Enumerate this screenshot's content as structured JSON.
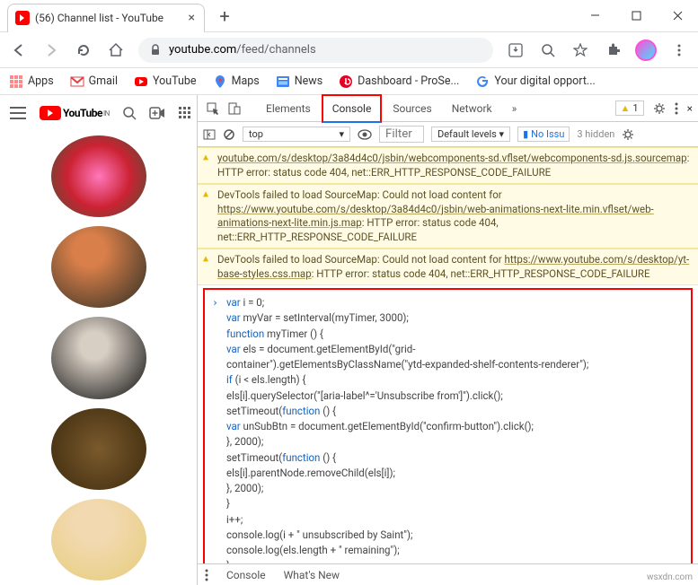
{
  "window": {
    "tab_title": "(56) Channel list - YouTube",
    "url_domain": "youtube.com",
    "url_path": "/feed/channels"
  },
  "bookmarks": [
    {
      "label": "Apps"
    },
    {
      "label": "Gmail"
    },
    {
      "label": "YouTube"
    },
    {
      "label": "Maps"
    },
    {
      "label": "News"
    },
    {
      "label": "Dashboard - ProSe..."
    },
    {
      "label": "Your digital opport..."
    }
  ],
  "youtube": {
    "brand": "YouTube",
    "region": "IN"
  },
  "devtools": {
    "tabs": [
      "Elements",
      "Console",
      "Sources",
      "Network"
    ],
    "active_tab": "Console",
    "issues_count": "1",
    "context": "top",
    "filter_placeholder": "Filter",
    "levels": "Default levels",
    "no_issues": "No Issu",
    "hidden": "3 hidden",
    "warnings": [
      {
        "pre": "",
        "link": "youtube.com/s/desktop/3a84d4c0/jsbin/webcomponents-sd.vflset/webcomponents-sd.js.sourcemap",
        "post": ": HTTP error: status code 404, net::ERR_HTTP_RESPONSE_CODE_FAILURE"
      },
      {
        "pre": "DevTools failed to load SourceMap: Could not load content for ",
        "link": "https://www.youtube.com/s/desktop/3a84d4c0/jsbin/web-animations-next-lite.min.vflset/web-animations-next-lite.min.js.map",
        "post": ": HTTP error: status code 404, net::ERR_HTTP_RESPONSE_CODE_FAILURE"
      },
      {
        "pre": "DevTools failed to load SourceMap: Could not load content for ",
        "link": "https://www.youtube.com/s/desktop/yt-base-styles.css.map",
        "post": ": HTTP error: status code 404, net::ERR_HTTP_RESPONSE_CODE_FAILURE"
      }
    ],
    "code": {
      "l1a": "var",
      "l1b": " i = 0;",
      "l2a": "var",
      "l2b": " myVar = setInterval(myTimer, 3000);",
      "l3a": "function",
      "l3b": " myTimer () {",
      "l4a": "var",
      "l4b": " els = document.getElementById(\"grid-",
      "l5": "container\").getElementsByClassName(\"ytd-expanded-shelf-contents-renderer\");",
      "l6a": "if",
      "l6b": " (i < els.length) {",
      "l7": "els[i].querySelector(\"[aria-label^='Unsubscribe from']\").click();",
      "l8a": "setTimeout(",
      "l8b": "function",
      "l8c": " () {",
      "l9a": "var",
      "l9b": " unSubBtn = document.getElementById(\"confirm-button\").click();",
      "l10": "}, 2000);",
      "l11a": "setTimeout(",
      "l11b": "function",
      "l11c": " () {",
      "l12": "els[i].parentNode.removeChild(els[i]);",
      "l13": "}, 2000);",
      "l14": "}",
      "l15": "i++;",
      "l16": "console.log(i + \" unsubscribed by Saint\");",
      "l17": "console.log(els.length + \" remaining\");",
      "l18": "}"
    },
    "drawer": [
      "Console",
      "What's New"
    ]
  },
  "watermark": "wsxdn.com"
}
